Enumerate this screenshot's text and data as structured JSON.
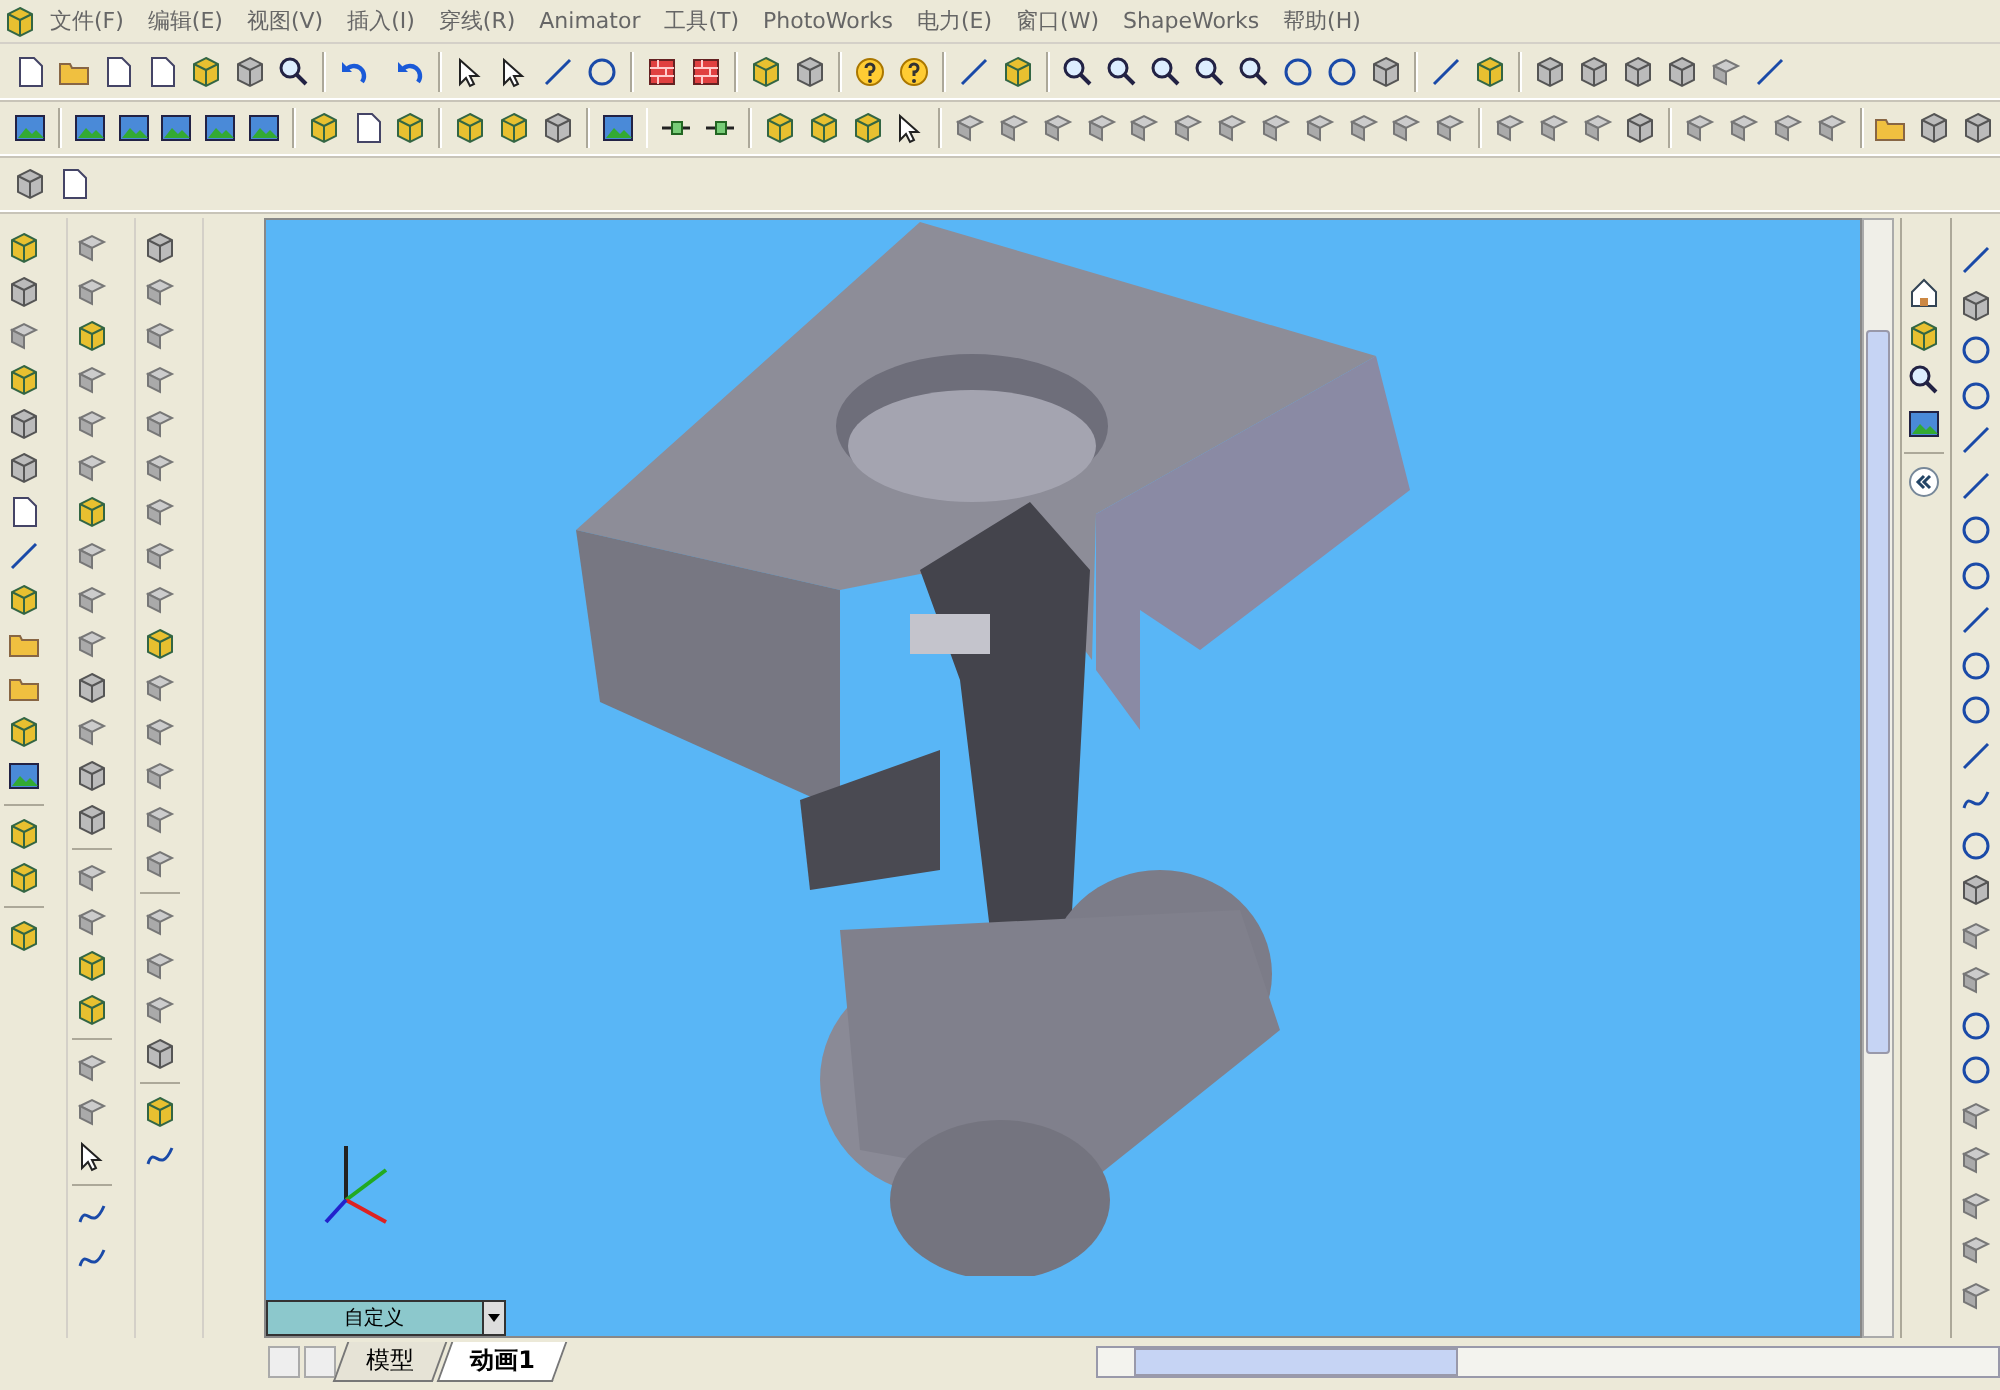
{
  "menu_bar": [
    {
      "label": "文件(F)"
    },
    {
      "label": "编辑(E)"
    },
    {
      "label": "视图(V)"
    },
    {
      "label": "插入(I)"
    },
    {
      "label": "穿线(R)"
    },
    {
      "label": "Animator"
    },
    {
      "label": "工具(T)"
    },
    {
      "label": "PhotoWorks"
    },
    {
      "label": "电力(E)"
    },
    {
      "label": "窗口(W)"
    },
    {
      "label": "ShapeWorks"
    },
    {
      "label": "帮助(H)"
    }
  ],
  "viewport": {
    "view_dropdown": "自定义"
  },
  "sheet_tabs": [
    {
      "label": "模型",
      "selected": false
    },
    {
      "label": "动画1",
      "selected": true
    }
  ]
}
